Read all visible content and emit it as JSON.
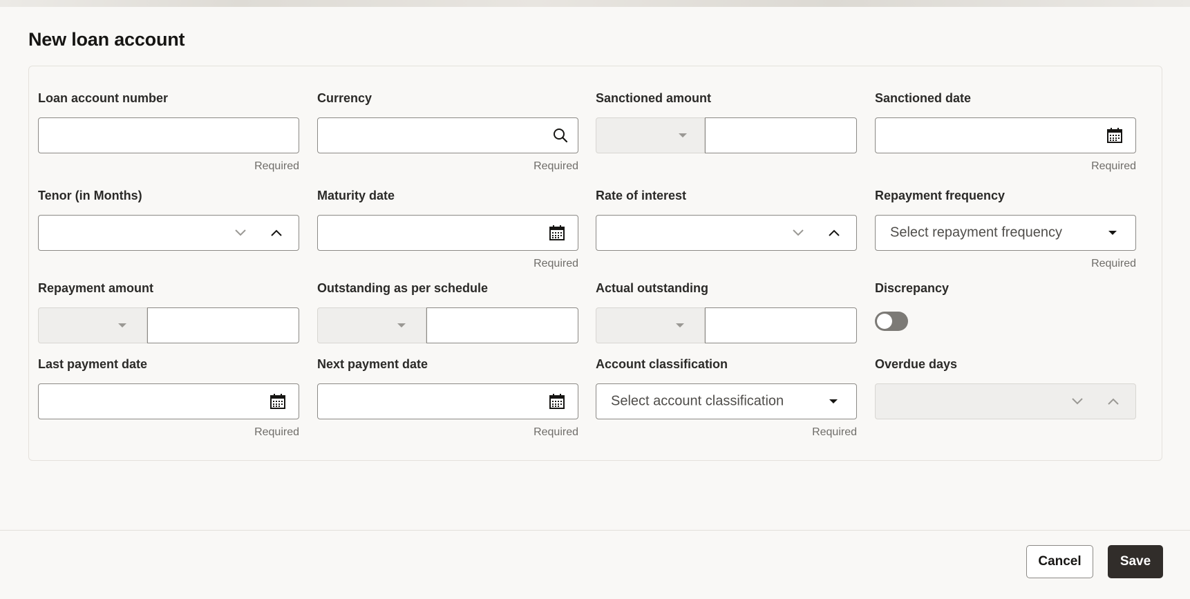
{
  "form": {
    "title": "New loan account",
    "required_text": "Required",
    "fields": {
      "loan_account_number": {
        "label": "Loan account number",
        "value": ""
      },
      "currency": {
        "label": "Currency",
        "value": ""
      },
      "sanctioned_amount": {
        "label": "Sanctioned amount",
        "currency": "",
        "value": ""
      },
      "sanctioned_date": {
        "label": "Sanctioned date",
        "value": ""
      },
      "tenor": {
        "label": "Tenor (in Months)",
        "value": ""
      },
      "maturity_date": {
        "label": "Maturity date",
        "value": ""
      },
      "rate_of_interest": {
        "label": "Rate of interest",
        "value": ""
      },
      "repayment_frequency": {
        "label": "Repayment frequency",
        "placeholder": "Select repayment frequency"
      },
      "repayment_amount": {
        "label": "Repayment amount",
        "currency": "",
        "value": ""
      },
      "outstanding_schedule": {
        "label": "Outstanding as per schedule",
        "currency": "",
        "value": ""
      },
      "actual_outstanding": {
        "label": "Actual outstanding",
        "currency": "",
        "value": ""
      },
      "discrepancy": {
        "label": "Discrepancy",
        "checked": false
      },
      "last_payment_date": {
        "label": "Last payment date",
        "value": ""
      },
      "next_payment_date": {
        "label": "Next payment date",
        "value": ""
      },
      "account_classification": {
        "label": "Account classification",
        "placeholder": "Select account classification"
      },
      "overdue_days": {
        "label": "Overdue days",
        "value": ""
      }
    }
  },
  "footer": {
    "cancel_label": "Cancel",
    "save_label": "Save"
  },
  "icons": {
    "search": "search-icon",
    "calendar": "calendar-icon",
    "dropdown": "caret-down-icon",
    "step_down": "chevron-down-icon",
    "step_up": "chevron-up-icon"
  },
  "colors": {
    "primary_button": "#312d2a",
    "background": "#f9f8f6",
    "toggle_off": "#7c7a76"
  }
}
